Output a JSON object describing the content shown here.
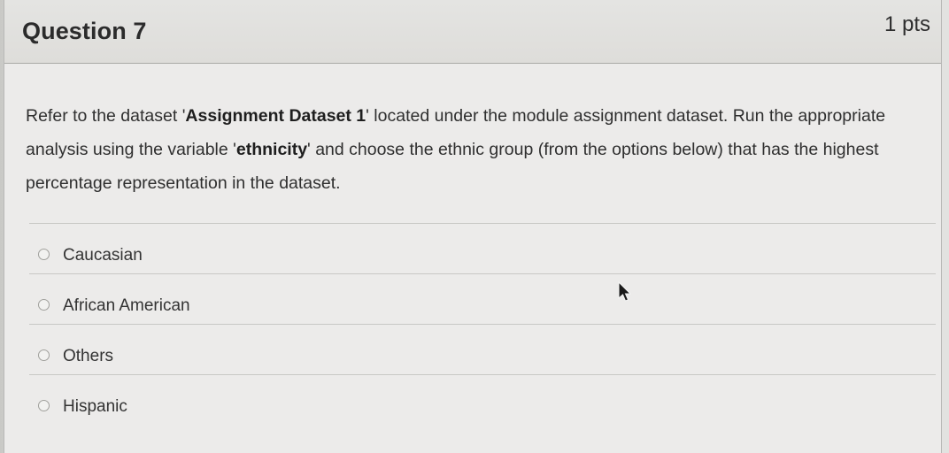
{
  "question": {
    "title": "Question 7",
    "points": "1 pts"
  },
  "prompt": {
    "part1": "Refer to the dataset '",
    "dataset_name": "Assignment Dataset 1",
    "part2": "' located under the module assignment dataset. Run the appropriate analysis using the variable '",
    "variable": "ethnicity",
    "part3": "' and choose the ethnic group (from the options below) that has the highest percentage representation in the dataset."
  },
  "answers": [
    {
      "label": "Caucasian"
    },
    {
      "label": "African American"
    },
    {
      "label": "Others"
    },
    {
      "label": "Hispanic"
    }
  ],
  "icons": {
    "radio": "radio-button-icon",
    "cursor": "mouse-pointer-icon"
  }
}
